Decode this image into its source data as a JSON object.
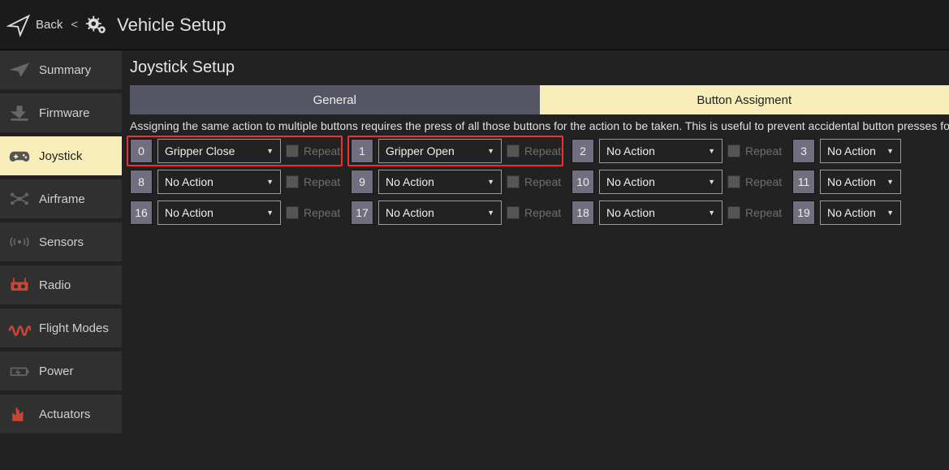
{
  "topbar": {
    "back_label": "Back",
    "angle": "<",
    "title": "Vehicle Setup"
  },
  "sidebar": {
    "items": [
      {
        "key": "summary",
        "label": "Summary"
      },
      {
        "key": "firmware",
        "label": "Firmware"
      },
      {
        "key": "joystick",
        "label": "Joystick"
      },
      {
        "key": "airframe",
        "label": "Airframe"
      },
      {
        "key": "sensors",
        "label": "Sensors"
      },
      {
        "key": "radio",
        "label": "Radio"
      },
      {
        "key": "flightmodes",
        "label": "Flight Modes"
      },
      {
        "key": "power",
        "label": "Power"
      },
      {
        "key": "actuators",
        "label": "Actuators"
      }
    ]
  },
  "page": {
    "title": "Joystick Setup",
    "tabs": {
      "general": "General",
      "assign": "Button Assigment"
    },
    "info": "Assigning the same action to multiple buttons requires the press of all those buttons for the action to be taken. This is useful to prevent accidental button presses for critical act",
    "repeat_label": "Repeat"
  },
  "buttons": [
    [
      {
        "num": "0",
        "action": "Gripper Close",
        "highlight": true
      },
      {
        "num": "1",
        "action": "Gripper Open",
        "highlight": true
      },
      {
        "num": "2",
        "action": "No Action"
      },
      {
        "num": "3",
        "action": "No Action",
        "narrow": true
      }
    ],
    [
      {
        "num": "8",
        "action": "No Action"
      },
      {
        "num": "9",
        "action": "No Action"
      },
      {
        "num": "10",
        "action": "No Action"
      },
      {
        "num": "11",
        "action": "No Action",
        "narrow": true
      }
    ],
    [
      {
        "num": "16",
        "action": "No Action"
      },
      {
        "num": "17",
        "action": "No Action"
      },
      {
        "num": "18",
        "action": "No Action"
      },
      {
        "num": "19",
        "action": "No Action",
        "narrow": true
      }
    ]
  ]
}
